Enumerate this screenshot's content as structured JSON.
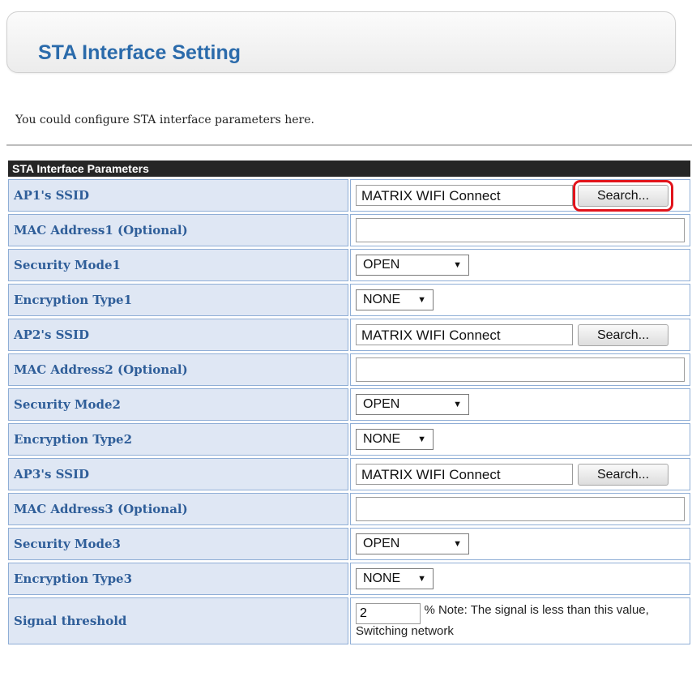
{
  "page": {
    "title": "STA Interface Setting",
    "intro": "You could configure STA interface parameters here."
  },
  "table": {
    "header": "STA Interface Parameters",
    "ap1": {
      "ssid_label": "AP1's SSID",
      "ssid_value": "MATRIX WIFI Connect",
      "search_label": "Search...",
      "mac_label": "MAC Address1 (Optional)",
      "mac_value": "",
      "security_label": "Security Mode1",
      "security_value": "OPEN",
      "encryption_label": "Encryption Type1",
      "encryption_value": "NONE"
    },
    "ap2": {
      "ssid_label": "AP2's SSID",
      "ssid_value": "MATRIX WIFI Connect",
      "search_label": "Search...",
      "mac_label": "MAC Address2 (Optional)",
      "mac_value": "",
      "security_label": "Security Mode2",
      "security_value": "OPEN",
      "encryption_label": "Encryption Type2",
      "encryption_value": "NONE"
    },
    "ap3": {
      "ssid_label": "AP3's SSID",
      "ssid_value": "MATRIX WIFI Connect",
      "search_label": "Search...",
      "mac_label": "MAC Address3 (Optional)",
      "mac_value": "",
      "security_label": "Security Mode3",
      "security_value": "OPEN",
      "encryption_label": "Encryption Type3",
      "encryption_value": "NONE"
    },
    "signal": {
      "label": "Signal threshold",
      "value": "2",
      "note": "% Note: The signal is less than this value, Switching network"
    }
  },
  "icons": {
    "dropdown": "chevron-down-icon"
  },
  "colors": {
    "title": "#2b6bab",
    "label_text": "#2f5e99",
    "label_bg": "#dfe7f4",
    "header_bg": "#262626",
    "highlight": "#e1141c"
  }
}
